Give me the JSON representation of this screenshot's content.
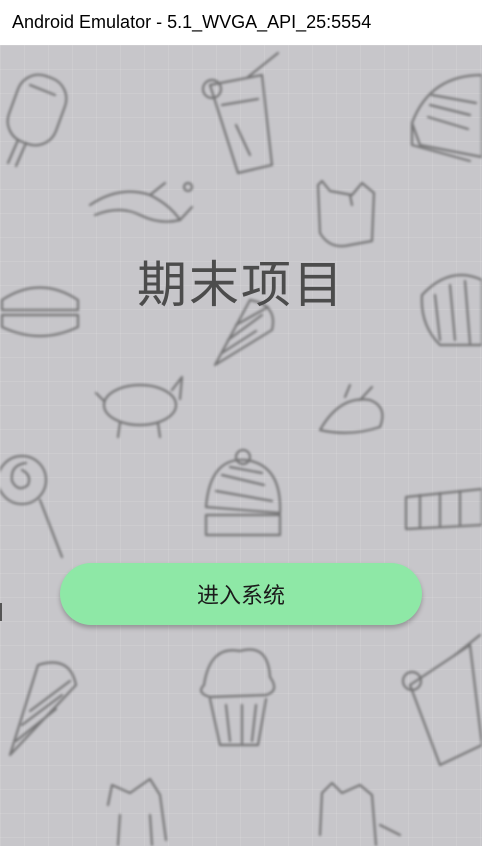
{
  "window": {
    "title": "Android Emulator - 5.1_WVGA_API_25:5554"
  },
  "screen": {
    "headline": "期末项目",
    "enter_button_label": "进入系统"
  },
  "colors": {
    "background": "#c7c6ca",
    "button": "#8ee8a6",
    "headline_text": "#4c4c4c"
  },
  "background_icons": [
    "popsicle-icon",
    "drink-cup-icon",
    "knit-hat-icon",
    "bird-icon",
    "cat-icon",
    "macaron-icon",
    "ice-cream-cone-icon",
    "shell-cookie-icon",
    "pig-icon",
    "lollipop-icon",
    "chocolate-bar-icon",
    "cupcake-icon"
  ]
}
